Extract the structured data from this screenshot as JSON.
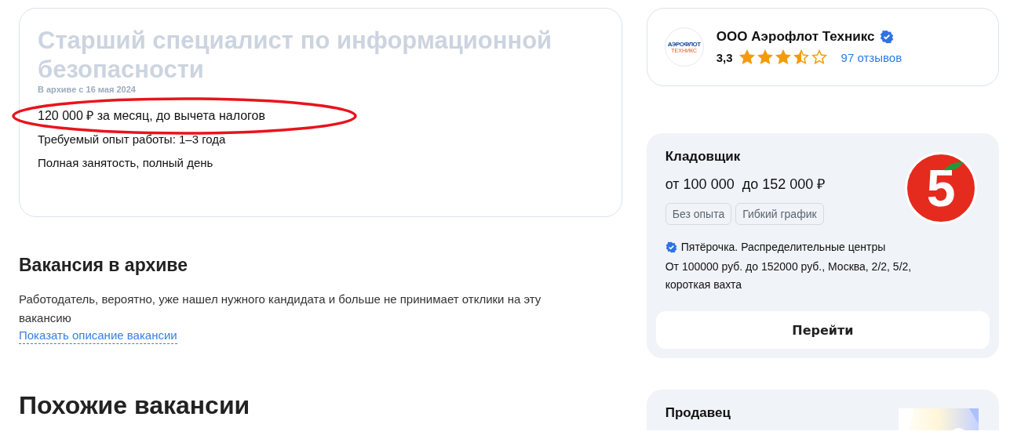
{
  "vacancy": {
    "title": "Старший специалист по информационной безопасности",
    "archived_note": "В архиве с 16 мая 2024",
    "salary": "120 000 ₽ за месяц, до вычета налогов",
    "salary_highlighted": true,
    "details": [
      "Требуемый опыт работы: 1–3 года",
      "Полная занятость, полный день"
    ]
  },
  "archive": {
    "heading": "Вакансия в архиве",
    "text": "Работодатель, вероятно, уже нашел нужного кандидата и больше не принимает отклики на эту вакансию",
    "link": "Показать описание вакансии"
  },
  "similar": {
    "heading": "Похожие вакансии"
  },
  "employer": {
    "logo_lines": [
      "АЭРОФЛОТ",
      "ТЕХНИКС"
    ],
    "name": "ООО Аэрофлот Техникс",
    "verified": true,
    "rating": "3,3",
    "stars": 3.5,
    "reviews": "97 отзывов"
  },
  "cards": [
    {
      "title": "Кладовщик",
      "salary": "от 100 000  до 152 000 ₽",
      "tags": [
        "Без опыта",
        "Гибкий график"
      ],
      "company": "Пятёрочка. Распределительные центры",
      "verified": true,
      "description": "От 100000 руб. до 152000 руб., Москва, 2/2, 5/2, короткая вахта",
      "button": "Перейти",
      "logo": {
        "kind": "five",
        "glyph": "5"
      }
    },
    {
      "title": "Продавец"
    }
  ]
}
